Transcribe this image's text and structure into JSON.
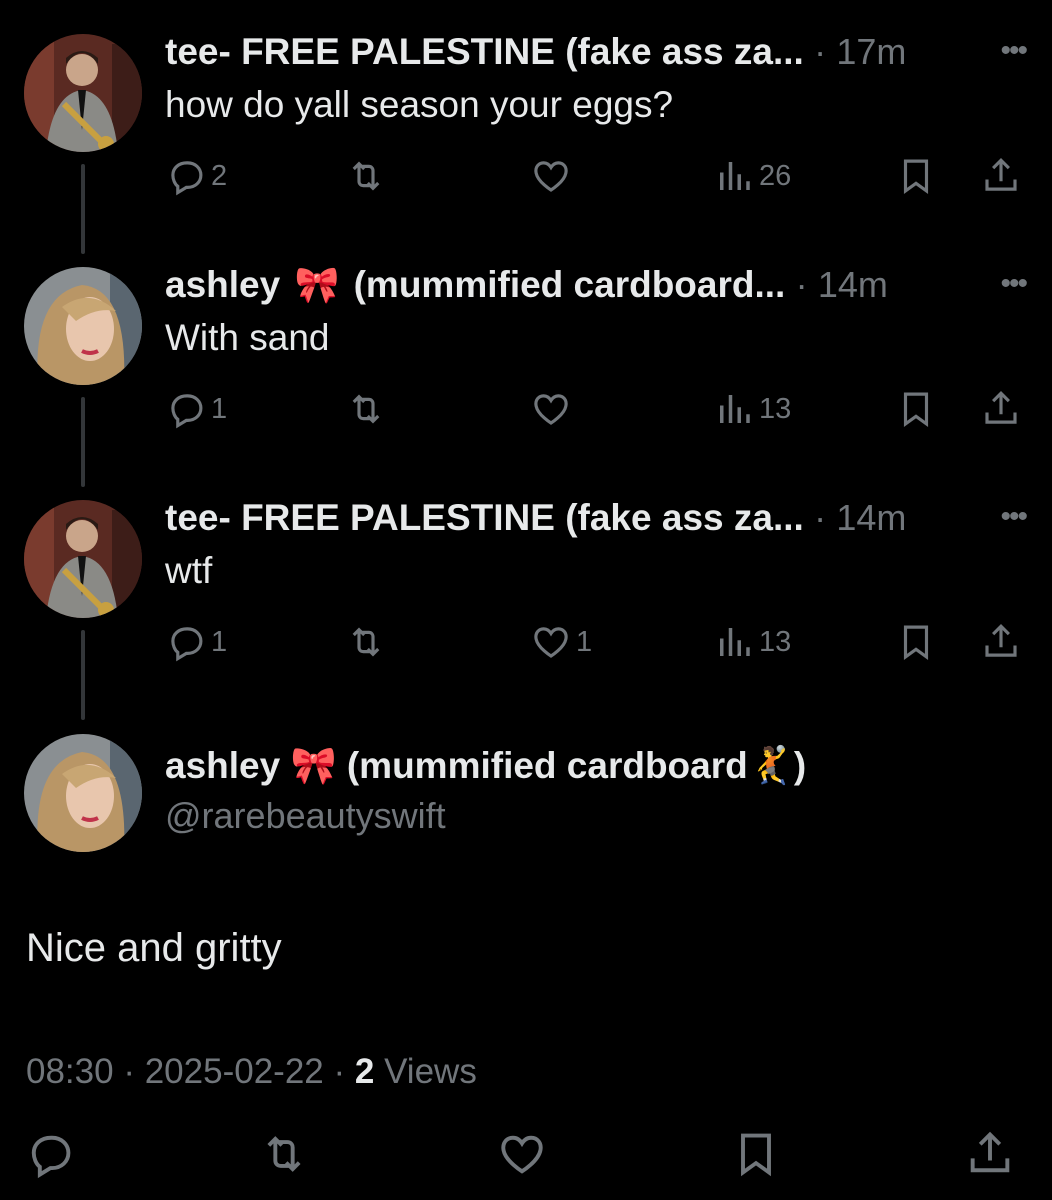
{
  "thread": [
    {
      "author": "tee- FREE PALESTINE (fake ass za...",
      "avatar": "man-with-trumpet-avatar",
      "time": "17m",
      "text": "how do yall season your eggs?",
      "replies": "2",
      "reposts": "",
      "likes": "",
      "views": "26"
    },
    {
      "author_prefix": "ashley",
      "author_emoji": "🎀",
      "author_suffix": "(mummified cardboard...",
      "avatar": "blonde-woman-avatar",
      "time": "14m",
      "text": "With sand",
      "replies": "1",
      "reposts": "",
      "likes": "",
      "views": "13"
    },
    {
      "author": "tee- FREE PALESTINE (fake ass za...",
      "avatar": "man-with-trumpet-avatar",
      "time": "14m",
      "text": "wtf",
      "replies": "1",
      "reposts": "",
      "likes": "1",
      "views": "13"
    }
  ],
  "main": {
    "author_prefix": "ashley",
    "author_emoji": "🎀",
    "author_suffix": "(mummified cardboard",
    "author_emoji2": "🤾",
    "author_close": ")",
    "handle": "@rarebeautyswift",
    "text": "Nice and gritty",
    "time": "08:30",
    "date": "2025-02-22",
    "views_count": "2",
    "views_label": "Views"
  },
  "separator": "·",
  "more": "•••",
  "colors": {
    "background": "#000000",
    "text": "#e7e9ea",
    "muted": "#71767b",
    "thread_line": "#333639",
    "bow": "#f4a6c8"
  }
}
